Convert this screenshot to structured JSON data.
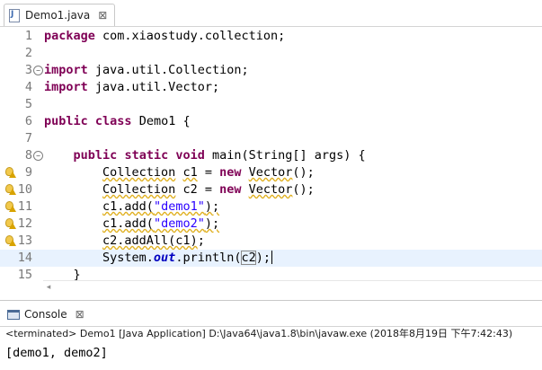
{
  "editor": {
    "tab_label": "Demo1.java",
    "tab_close": "⊠",
    "lines": [
      {
        "no": "1",
        "segments": [
          {
            "t": "package",
            "c": "kw"
          },
          {
            "t": " com.xiaostudy.collection;"
          }
        ]
      },
      {
        "no": "2",
        "segments": []
      },
      {
        "no": "3",
        "fold": "−",
        "segments": [
          {
            "t": "import",
            "c": "kw"
          },
          {
            "t": " java.util.Collection;"
          }
        ]
      },
      {
        "no": "4",
        "segments": [
          {
            "t": "import",
            "c": "kw"
          },
          {
            "t": " java.util.Vector;"
          }
        ]
      },
      {
        "no": "5",
        "segments": []
      },
      {
        "no": "6",
        "segments": [
          {
            "t": "public",
            "c": "kw"
          },
          {
            "t": " "
          },
          {
            "t": "class",
            "c": "kw"
          },
          {
            "t": " Demo1 {"
          }
        ]
      },
      {
        "no": "7",
        "segments": []
      },
      {
        "no": "8",
        "fold": "−",
        "segments": [
          {
            "t": "    "
          },
          {
            "t": "public",
            "c": "kw"
          },
          {
            "t": " "
          },
          {
            "t": "static",
            "c": "kw"
          },
          {
            "t": " "
          },
          {
            "t": "void",
            "c": "kw"
          },
          {
            "t": " main(String[] args) {"
          }
        ]
      },
      {
        "no": "9",
        "icon": "warning-bulb-icon",
        "segments": [
          {
            "t": "        "
          },
          {
            "t": "Collection",
            "c": "warnvar"
          },
          {
            "t": " "
          },
          {
            "t": "c1",
            "c": "warnvar"
          },
          {
            "t": " = "
          },
          {
            "t": "new",
            "c": "kw"
          },
          {
            "t": " "
          },
          {
            "t": "Vector",
            "c": "warnvar"
          },
          {
            "t": "();"
          }
        ]
      },
      {
        "no": "10",
        "icon": "warning-bulb-icon",
        "segments": [
          {
            "t": "        "
          },
          {
            "t": "Collection",
            "c": "warnvar"
          },
          {
            "t": " c2 = "
          },
          {
            "t": "new",
            "c": "kw"
          },
          {
            "t": " "
          },
          {
            "t": "Vector",
            "c": "warnvar"
          },
          {
            "t": "();"
          }
        ]
      },
      {
        "no": "11",
        "icon": "warning-bulb-icon",
        "segments": [
          {
            "t": "        "
          },
          {
            "t": "c1.add(",
            "c": "warnvar"
          },
          {
            "t": "\"demo1\"",
            "c": "str warnvar"
          },
          {
            "t": ");",
            "c": "warnvar"
          }
        ]
      },
      {
        "no": "12",
        "icon": "warning-bulb-icon",
        "segments": [
          {
            "t": "        "
          },
          {
            "t": "c1.add(",
            "c": "warnvar"
          },
          {
            "t": "\"demo2\"",
            "c": "str warnvar"
          },
          {
            "t": ");",
            "c": "warnvar"
          }
        ]
      },
      {
        "no": "13",
        "icon": "warning-bulb-icon",
        "segments": [
          {
            "t": "        "
          },
          {
            "t": "c2.addAll(c1)",
            "c": "warnvar"
          },
          {
            "t": ";"
          }
        ]
      },
      {
        "no": "14",
        "current": true,
        "segments": [
          {
            "t": "        System."
          },
          {
            "t": "out",
            "c": "field"
          },
          {
            "t": ".println("
          },
          {
            "t": "c2",
            "c": "boxed"
          },
          {
            "t": ");"
          },
          {
            "t": "",
            "c": "caret"
          }
        ]
      },
      {
        "no": "15",
        "segments": [
          {
            "t": "    }"
          }
        ]
      }
    ]
  },
  "scrollbar": {
    "left_arrow": "◂"
  },
  "console": {
    "tab_label": "Console",
    "tab_close": "⊠",
    "status": "<terminated> Demo1 [Java Application] D:\\Java64\\java1.8\\bin\\javaw.exe (2018年8月19日 下午7:42:43)",
    "output": "[demo1, demo2]"
  },
  "colors": {
    "keyword": "#7f0055",
    "string": "#2a00ff",
    "static_field": "#0000c0",
    "current_line": "#e8f2fe",
    "warning_underline": "#e0b020"
  }
}
